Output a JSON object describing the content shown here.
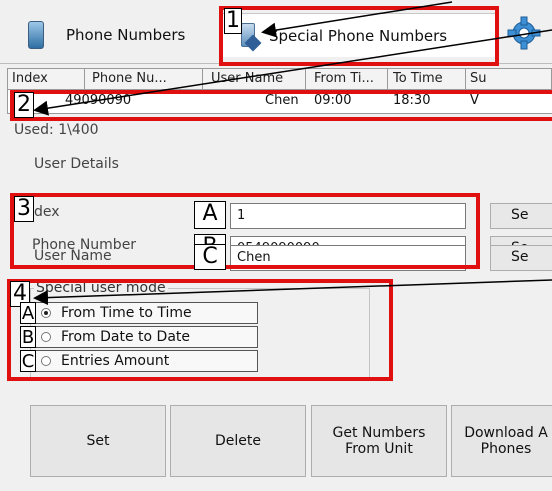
{
  "tabs": [
    {
      "label": "Phone Numbers",
      "icon": "phone-icon"
    },
    {
      "label": "Special Phone Numbers",
      "icon": "special-phone-icon"
    },
    {
      "label": "",
      "icon": "gear-icon"
    }
  ],
  "grid": {
    "columns": [
      "Index",
      "Phone Nu...",
      "User Name",
      "From Ti...",
      "To Time",
      "Su"
    ],
    "rows": [
      {
        "index": "",
        "phone": "49090090",
        "user": "Chen",
        "from": "09:00",
        "to": "18:30",
        "su": "V"
      }
    ]
  },
  "used_text": "Used: 1\\400",
  "user_details": {
    "group_label": "User Details",
    "index_label": "dex",
    "index_value": "1",
    "phone_label": "Phone Number",
    "phone_value": "0549090090",
    "username_label": "User Name",
    "username_value": "Chen",
    "set_label": "Se"
  },
  "special_mode": {
    "group_label": "Special user mode",
    "options": [
      "From Time to Time",
      "From Date to Date",
      "Entries Amount"
    ],
    "selected": "From Time to Time"
  },
  "buttons": {
    "set": "Set",
    "delete": "Delete",
    "get_numbers_line1": "Get Numbers",
    "get_numbers_line2": "From Unit",
    "download_line1": "Download A",
    "download_line2": "Phones"
  },
  "annotations": {
    "n1": "1",
    "n2": "2",
    "n3": "3",
    "n4": "4",
    "a": "A",
    "b": "B",
    "c": "C"
  },
  "colors": {
    "annotation_red": "#e01010"
  }
}
